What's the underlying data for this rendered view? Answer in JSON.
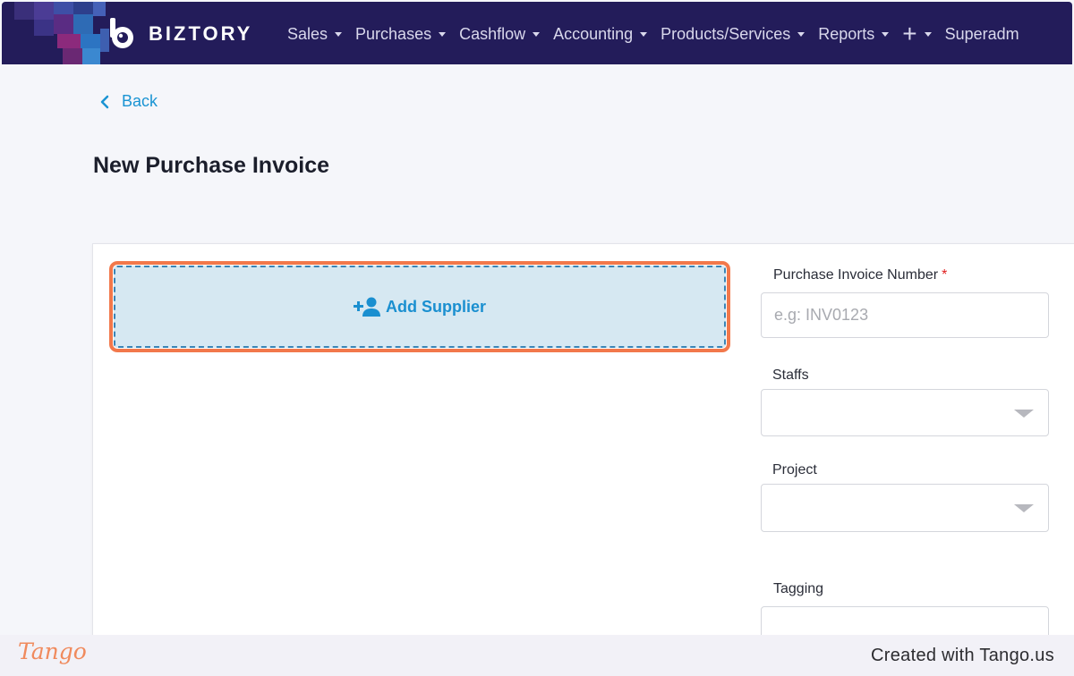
{
  "navbar": {
    "brand": "BIZTORY",
    "items": [
      {
        "label": "Sales"
      },
      {
        "label": "Purchases"
      },
      {
        "label": "Cashflow"
      },
      {
        "label": "Accounting"
      },
      {
        "label": "Products/Services"
      },
      {
        "label": "Reports"
      }
    ],
    "plus_label": "+",
    "user_label": "Superadm"
  },
  "page": {
    "back_label": "Back",
    "title": "New Purchase Invoice"
  },
  "supplier": {
    "add_label": "Add Supplier"
  },
  "form": {
    "invoice_number": {
      "label": "Purchase Invoice Number",
      "required_mark": "*",
      "placeholder": "e.g: INV0123",
      "value": ""
    },
    "staffs": {
      "label": "Staffs",
      "value": ""
    },
    "project": {
      "label": "Project",
      "value": ""
    },
    "tagging": {
      "label": "Tagging",
      "value": ""
    }
  },
  "footer": {
    "logo": "Tango",
    "credit": "Created with Tango.us"
  },
  "colors": {
    "navbar_bg": "#231c5a",
    "accent_blue": "#1a94d3",
    "highlight_orange": "#f2784b",
    "supplier_bg": "#d6e8f2"
  }
}
